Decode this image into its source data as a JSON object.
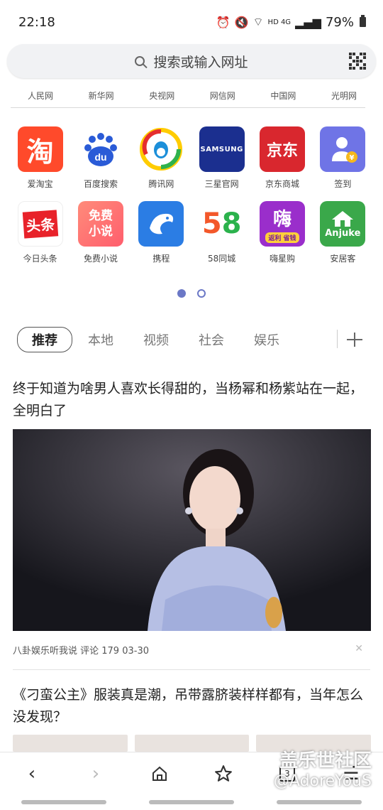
{
  "status": {
    "time": "22:18",
    "network": "HD 4G",
    "battery": "79%"
  },
  "search": {
    "placeholder": "搜索或输入网址"
  },
  "quick_links": [
    "人民网",
    "新华网",
    "央视网",
    "网信网",
    "中国网",
    "光明网"
  ],
  "apps": [
    {
      "label": "爱淘宝",
      "icon": "taobao-icon",
      "glyph": "淘",
      "color": "#ff4a2b"
    },
    {
      "label": "百度搜索",
      "icon": "baidu-icon",
      "glyph": "du",
      "color": "#2a5bd7"
    },
    {
      "label": "腾讯网",
      "icon": "tencent-icon",
      "glyph": "",
      "color": "#ffffff"
    },
    {
      "label": "三星官网",
      "icon": "samsung-icon",
      "glyph": "SAMSUNG",
      "color": "#1b2f8f"
    },
    {
      "label": "京东商城",
      "icon": "jd-icon",
      "glyph": "京东",
      "color": "#d9272e"
    },
    {
      "label": "签到",
      "icon": "signin-icon",
      "glyph": "",
      "color": "#6f74e6"
    },
    {
      "label": "今日头条",
      "icon": "toutiao-icon",
      "glyph": "头条",
      "color": "#ffffff"
    },
    {
      "label": "免费小说",
      "icon": "novel-icon",
      "glyph": "免费\n小说",
      "color": "#ff6a6a"
    },
    {
      "label": "携程",
      "icon": "ctrip-icon",
      "glyph": "",
      "color": "#2b7de4"
    },
    {
      "label": "58同城",
      "icon": "58-icon",
      "glyph": "58",
      "color": "#ffffff"
    },
    {
      "label": "嗨星购",
      "icon": "haixinggou-icon",
      "glyph": "嗨",
      "color": "#9a2ecb"
    },
    {
      "label": "安居客",
      "icon": "anjuke-icon",
      "glyph": "Anjuke",
      "color": "#3aa84a"
    }
  ],
  "pager": {
    "pages": 2,
    "active": 1
  },
  "tabs": [
    {
      "label": "推荐",
      "active": true
    },
    {
      "label": "本地",
      "active": false
    },
    {
      "label": "视频",
      "active": false
    },
    {
      "label": "社会",
      "active": false
    },
    {
      "label": "娱乐",
      "active": false
    }
  ],
  "articles": [
    {
      "title": "终于知道为啥男人喜欢长得甜的，当杨幂和杨紫站在一起，全明白了",
      "meta": "八卦娱乐听我说  评论 179  03-30"
    },
    {
      "title": "《刁蛮公主》服装真是潮，吊带露脐装样样都有，当年怎么没发现？"
    }
  ],
  "bottom_nav": {
    "tabs_count": "3"
  },
  "watermark": {
    "line1": "盖乐世社区",
    "line2": "@AdoreYouS"
  },
  "colors": {
    "accent": "#6b78c6"
  }
}
